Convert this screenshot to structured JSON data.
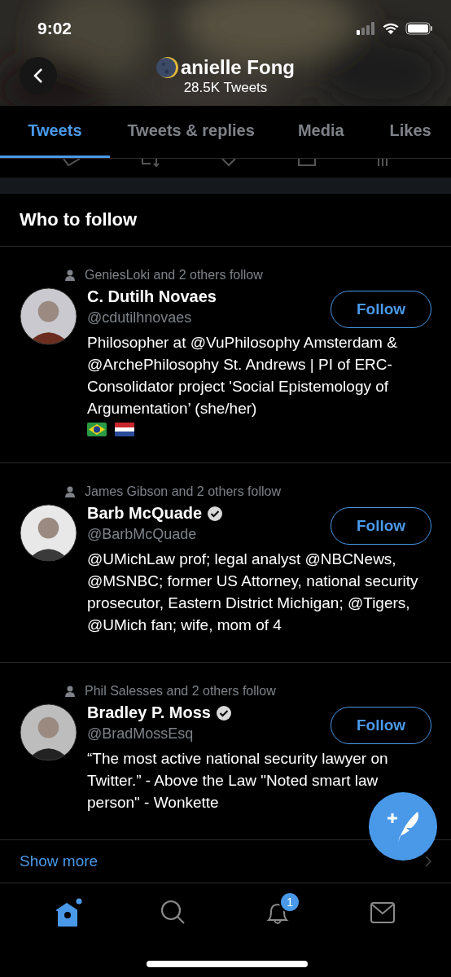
{
  "status_bar": {
    "time": "9:02"
  },
  "header": {
    "name": "anielle Fong",
    "subtitle": "28.5K Tweets"
  },
  "tabs": [
    {
      "label": "Tweets",
      "selected": true
    },
    {
      "label": "Tweets & replies",
      "selected": false
    },
    {
      "label": "Media",
      "selected": false
    },
    {
      "label": "Likes",
      "selected": false
    }
  ],
  "section_title": "Who to follow",
  "suggestions": [
    {
      "context": "GeniesLoki and 2 others follow",
      "name": "C. Dutilh Novaes",
      "verified": false,
      "handle": "@cdutilhnovaes",
      "button": "Follow",
      "bio": "Philosopher at @VuPhilosophy Amsterdam & @ArchePhilosophy St. Andrews | PI of ERC-Consolidator project 'Social Epistemology of Argumentation’ (she/her)",
      "flags": true
    },
    {
      "context": "James Gibson and 2 others follow",
      "name": "Barb McQuade",
      "verified": true,
      "handle": "@BarbMcQuade",
      "button": "Follow",
      "bio": "@UMichLaw prof; legal analyst @NBCNews, @MSNBC; former US Attorney, national security prosecutor, Eastern District Michigan; @Tigers, @UMich fan; wife, mom of 4",
      "flags": false
    },
    {
      "context": "Phil Salesses and 2 others follow",
      "name": "Bradley P. Moss",
      "verified": true,
      "handle": "@BradMossEsq",
      "button": "Follow",
      "bio": "“The most active national security lawyer on Twitter.” - Above the Law \"Noted smart law person\" - Wonkette",
      "flags": false
    }
  ],
  "show_more": "Show more",
  "nav": [
    {
      "kind": "home",
      "selected": true
    },
    {
      "kind": "search",
      "selected": false
    },
    {
      "kind": "notifications",
      "selected": false,
      "badge": "1"
    },
    {
      "kind": "messages",
      "selected": false
    }
  ]
}
